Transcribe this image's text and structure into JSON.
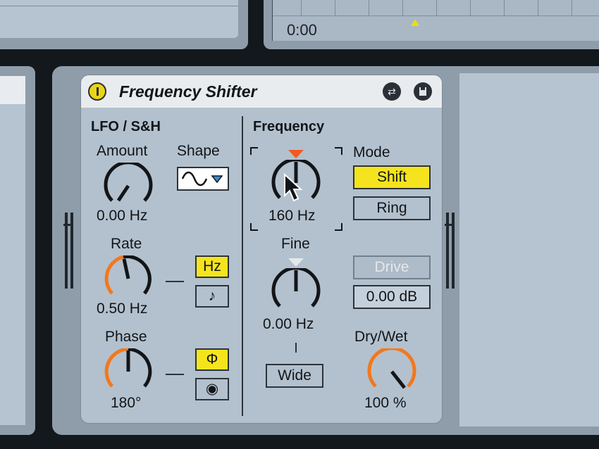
{
  "timeline": {
    "time_label": "0:00"
  },
  "device": {
    "title": "Frequency Shifter",
    "lfo": {
      "section_title": "LFO / S&H",
      "amount_label": "Amount",
      "amount_value": "0.00 Hz",
      "shape_label": "Shape",
      "rate_label": "Rate",
      "rate_value": "0.50 Hz",
      "rate_mode_hz": "Hz",
      "rate_mode_sync": "♪",
      "phase_label": "Phase",
      "phase_value": "180°",
      "phase_mode_phase": "Φ",
      "phase_mode_spin": "◉"
    },
    "frequency": {
      "section_title": "Frequency",
      "frequency_value": "160 Hz",
      "fine_label": "Fine",
      "fine_value": "0.00 Hz",
      "wide_label": "Wide",
      "mode_label": "Mode",
      "mode_shift": "Shift",
      "mode_ring": "Ring",
      "drive_label": "Drive",
      "drive_value": "0.00 dB",
      "drywet_label": "Dry/Wet",
      "drywet_value": "100 %"
    }
  },
  "colors": {
    "accent_yellow": "#f5e41d",
    "knob_orange": "#f2781e",
    "panel": "#b3c1ce",
    "title_bar": "#e9ecef"
  },
  "icons": [
    "power-icon",
    "hot-swap-icon",
    "save-preset-icon",
    "sine-wave-icon",
    "chevron-down-icon",
    "note-icon",
    "mouse-pointer-icon"
  ]
}
